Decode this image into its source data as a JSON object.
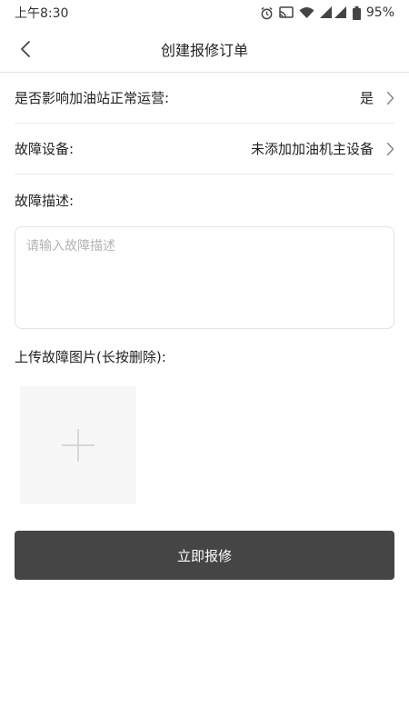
{
  "status_bar": {
    "time": "上午8:30",
    "battery": "95%",
    "icons": [
      "alarm-icon",
      "cast-icon",
      "wifi-icon",
      "signal-icon",
      "battery-icon"
    ]
  },
  "nav": {
    "title": "创建报修订单",
    "back_icon": "chevron-left-icon"
  },
  "form": {
    "affect_operation": {
      "label": "是否影响加油站正常运营:",
      "value": "是"
    },
    "device": {
      "label": "故障设备:",
      "value": "未添加加油机主设备"
    },
    "description": {
      "label": "故障描述:",
      "placeholder": "请输入故障描述",
      "value": ""
    },
    "upload": {
      "label": "上传故障图片(长按删除):",
      "icon": "plus-icon"
    }
  },
  "submit": {
    "label": "立即报修"
  },
  "colors": {
    "button_bg": "#454545",
    "divider": "#ededed",
    "upload_bg": "#f7f7f8",
    "placeholder": "#b3b3b3"
  }
}
